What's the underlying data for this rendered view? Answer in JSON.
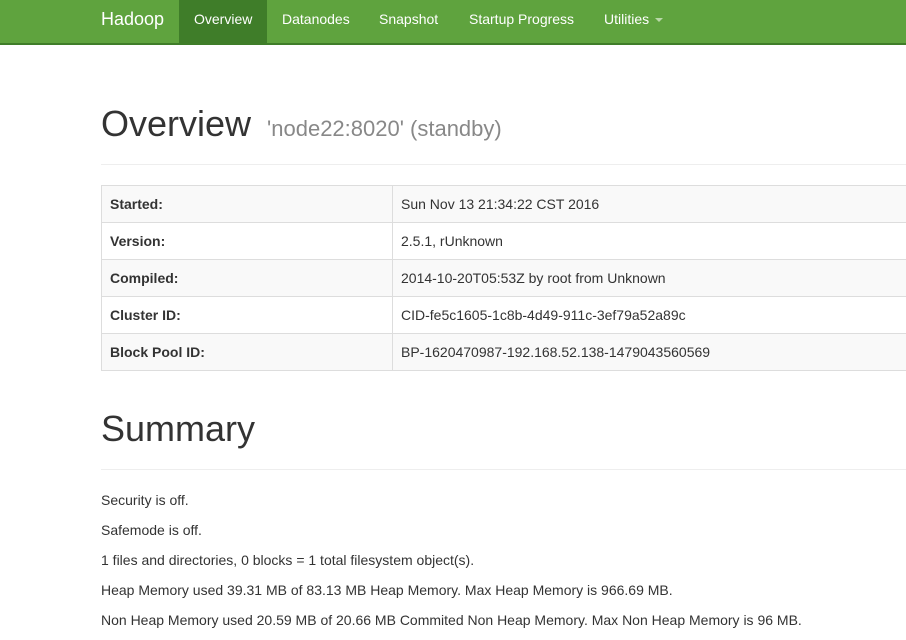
{
  "navbar": {
    "brand": "Hadoop",
    "items": [
      {
        "label": "Overview"
      },
      {
        "label": "Datanodes"
      },
      {
        "label": "Snapshot"
      },
      {
        "label": "Startup Progress"
      },
      {
        "label": "Utilities"
      }
    ],
    "active": "Overview",
    "colors": {
      "background": "#5fa33e",
      "active": "#3f7d29"
    }
  },
  "overview": {
    "title": "Overview",
    "subtitle": "'node22:8020' (standby)",
    "rows": [
      {
        "label": "Started:",
        "value": "Sun Nov 13 21:34:22 CST 2016"
      },
      {
        "label": "Version:",
        "value": "2.5.1, rUnknown"
      },
      {
        "label": "Compiled:",
        "value": "2014-10-20T05:53Z by root from Unknown"
      },
      {
        "label": "Cluster ID:",
        "value": "CID-fe5c1605-1c8b-4d49-911c-3ef79a52a89c"
      },
      {
        "label": "Block Pool ID:",
        "value": "BP-1620470987-192.168.52.138-1479043560569"
      }
    ]
  },
  "summary": {
    "title": "Summary",
    "lines": [
      "Security is off.",
      "Safemode is off.",
      "1 files and directories, 0 blocks = 1 total filesystem object(s).",
      "Heap Memory used 39.31 MB of 83.13 MB Heap Memory. Max Heap Memory is 966.69 MB.",
      "Non Heap Memory used 20.59 MB of 20.66 MB Commited Non Heap Memory. Max Non Heap Memory is 96 MB."
    ]
  }
}
